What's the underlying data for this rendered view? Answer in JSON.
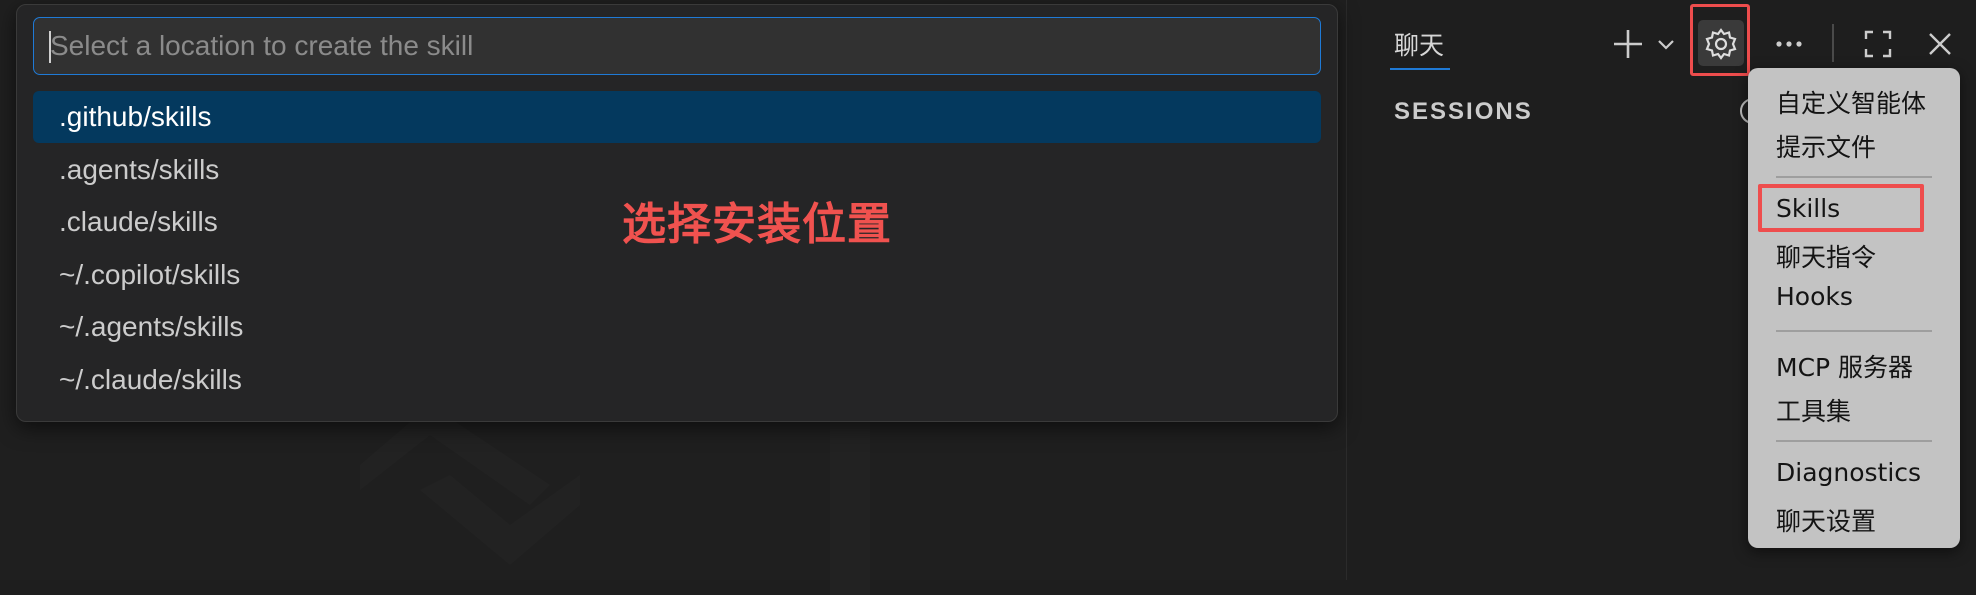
{
  "quickpick": {
    "placeholder": "Select a location to create the skill",
    "items": [
      {
        "label": ".github/skills",
        "selected": true
      },
      {
        "label": ".agents/skills"
      },
      {
        "label": ".claude/skills"
      },
      {
        "label": "~/.copilot/skills"
      },
      {
        "label": "~/.agents/skills"
      },
      {
        "label": "~/.claude/skills"
      }
    ]
  },
  "annotation": "选择安装位置",
  "chat": {
    "tab_label": "聊天",
    "sessions_label": "SESSIONS"
  },
  "toolbar": {
    "icons": [
      "plus-icon",
      "chevron-down-icon",
      "gear-icon",
      "ellipsis-icon",
      "maximize-icon",
      "close-icon"
    ]
  },
  "menu": {
    "items": [
      {
        "label": "自定义智能体"
      },
      {
        "label": "提示文件"
      },
      {
        "label": "Skills",
        "highlighted": true
      },
      {
        "label": "聊天指令"
      },
      {
        "label": "Hooks"
      },
      {
        "label": "MCP 服务器"
      },
      {
        "label": "工具集"
      },
      {
        "label": "Diagnostics"
      },
      {
        "label": "聊天设置"
      }
    ]
  },
  "colors": {
    "accent": "#1f7ad6",
    "selection": "#04395e",
    "annotation_red": "#ee4d4d",
    "menu_bg": "#c3c3c3"
  }
}
